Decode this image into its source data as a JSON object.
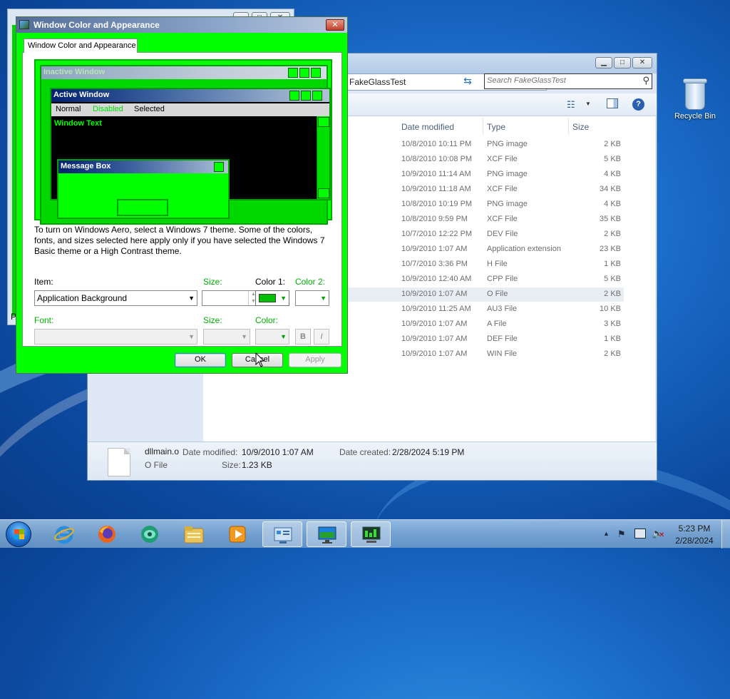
{
  "colors": {
    "dialog_bg": "#00ff00",
    "accent_green": "#00c000",
    "desktop_blue": "#1a6cc8"
  },
  "explorer": {
    "address_text": "FakeGlassTest",
    "search_placeholder": "Search FakeGlassTest",
    "columns": {
      "date": "Date modified",
      "type": "Type",
      "size": "Size"
    },
    "rows": [
      {
        "date": "10/8/2010 10:11 PM",
        "type": "PNG image",
        "size": "2 KB"
      },
      {
        "date": "10/8/2010 10:08 PM",
        "type": "XCF File",
        "size": "5 KB"
      },
      {
        "date": "10/9/2010 11:14 AM",
        "type": "PNG image",
        "size": "4 KB"
      },
      {
        "date": "10/9/2010 11:18 AM",
        "type": "XCF File",
        "size": "34 KB"
      },
      {
        "date": "10/8/2010 10:19 PM",
        "type": "PNG image",
        "size": "4 KB"
      },
      {
        "date": "10/8/2010 9:59 PM",
        "type": "XCF File",
        "size": "35 KB"
      },
      {
        "date": "10/7/2010 12:22 PM",
        "type": "DEV File",
        "size": "2 KB"
      },
      {
        "date": "10/9/2010 1:07 AM",
        "type": "Application extension",
        "size": "23 KB"
      },
      {
        "date": "10/7/2010 3:36 PM",
        "type": "H File",
        "size": "1 KB"
      },
      {
        "date": "10/9/2010 12:40 AM",
        "type": "CPP File",
        "size": "5 KB"
      },
      {
        "date": "10/9/2010 1:07 AM",
        "type": "O File",
        "size": "2 KB",
        "selected": true
      },
      {
        "date": "10/9/2010 11:25 AM",
        "type": "AU3 File",
        "size": "10 KB"
      },
      {
        "date": "10/9/2010 1:07 AM",
        "type": "A File",
        "size": "3 KB"
      },
      {
        "date": "10/9/2010 1:07 AM",
        "type": "DEF File",
        "size": "1 KB"
      },
      {
        "date": "10/9/2010 1:07 AM",
        "type": "WIN File",
        "size": "2 KB"
      }
    ],
    "details": {
      "filename": "dllmain.o",
      "filetype": "O File",
      "date_modified_label": "Date modified:",
      "date_modified": "10/9/2010 1:07 AM",
      "size_label": "Size:",
      "size": "1.23 KB",
      "date_created_label": "Date created:",
      "date_created": "2/28/2024 5:19 PM"
    }
  },
  "background_window": {
    "fragment": "P"
  },
  "dialog": {
    "title": "Window Color and Appearance",
    "tab_label": "Window Color and Appearance",
    "preview": {
      "inactive_title": "Inactive Window",
      "active_title": "Active Window",
      "menu_normal": "Normal",
      "menu_disabled": "Disabled",
      "menu_selected": "Selected",
      "window_text": "Window Text",
      "message_box_title": "Message Box"
    },
    "description": "To turn on Windows Aero, select a Windows 7 theme.  Some of the colors, fonts, and sizes selected here apply only if you have selected the Windows 7 Basic theme or a High Contrast theme.",
    "item_label": "Item:",
    "item_value": "Application Background",
    "size_label": "Size:",
    "color1_label": "Color 1:",
    "color2_label": "Color 2:",
    "font_label": "Font:",
    "font_size_label": "Size:",
    "font_color_label": "Color:",
    "bold_label": "B",
    "italic_label": "I",
    "ok_label": "OK",
    "cancel_label": "Cancel",
    "apply_label": "Apply"
  },
  "desktop": {
    "recycle_bin_label": "Recycle Bin"
  },
  "taskbar": {
    "items": [
      "internet-explorer",
      "firefox",
      "app-green-orb",
      "windows-explorer",
      "media-player",
      "control-panel",
      "display-settings",
      "system-monitor"
    ],
    "time": "5:23 PM",
    "date": "2/28/2024"
  }
}
